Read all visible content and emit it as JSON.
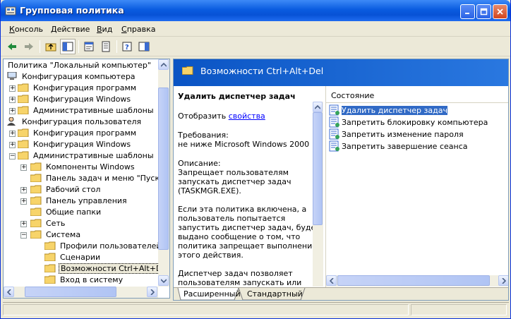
{
  "window": {
    "title": "Групповая политика"
  },
  "menu": [
    {
      "label": "Консоль",
      "accel": "К",
      "rest": "онсоль"
    },
    {
      "label": "Действие",
      "accel": "Д",
      "rest": "ействие"
    },
    {
      "label": "Вид",
      "accel": "В",
      "rest": "ид"
    },
    {
      "label": "Справка",
      "accel": "С",
      "rest": "правка"
    }
  ],
  "toolbar": [
    "back-icon",
    "forward-icon",
    "up-folder-icon",
    "show-hide-tree-icon",
    "properties-icon",
    "export-list-icon",
    "help-icon",
    "show-hide-action-pane-icon"
  ],
  "tree": {
    "root": "Политика \"Локальный компьютер\"",
    "computer_config": "Конфигурация компьютера",
    "c_software": "Конфигурация программ",
    "c_windows": "Конфигурация Windows",
    "c_admin": "Административные шаблоны",
    "user_config": "Конфигурация пользователя",
    "u_software": "Конфигурация программ",
    "u_windows": "Конфигурация Windows",
    "u_admin": "Административные шаблоны",
    "win_components": "Компоненты Windows",
    "taskbar": "Панель задач и меню \"Пуск\"",
    "desktop": "Рабочий стол",
    "control_panel": "Панель управления",
    "shared_folders": "Общие папки",
    "network": "Сеть",
    "system": "Система",
    "user_profiles": "Профили пользователей",
    "scripts": "Сценарии",
    "cad_options": "Возможности Ctrl+Alt+Del",
    "logon": "Вход в систему"
  },
  "details": {
    "header": "Возможности Ctrl+Alt+Del",
    "policy_title": "Удалить диспетчер задач",
    "show_label": "Отобразить ",
    "properties_link": "свойства",
    "req_label": "Требования:",
    "req_value": "не ниже Microsoft Windows 2000",
    "desc_label": "Описание:",
    "desc_lines": [
      "Запрещает пользователям",
      "запускать диспетчер задач",
      "(TASKMGR.EXE)."
    ],
    "body_lines": [
      "Если эта политика включена, а",
      "пользователь попытается",
      "запустить диспетчер задач, будет",
      "выдано сообщение о том, что",
      "политика запрещает выполнение",
      "этого действия."
    ],
    "tail_lines": [
      "Диспетчер задач позволяет",
      "пользователям запускать или"
    ]
  },
  "list": {
    "column": "Состояние",
    "items": [
      "Удалить диспетчер задач",
      "Запретить блокировку компьютера",
      "Запретить изменение пароля",
      "Запретить завершение сеанса"
    ]
  },
  "tabs": {
    "extended": "Расширенный",
    "standard": "Стандартный"
  },
  "colors": {
    "title_blue": "#0a5ce0",
    "selection": "#316ac5",
    "folder": "#f7d46a"
  }
}
